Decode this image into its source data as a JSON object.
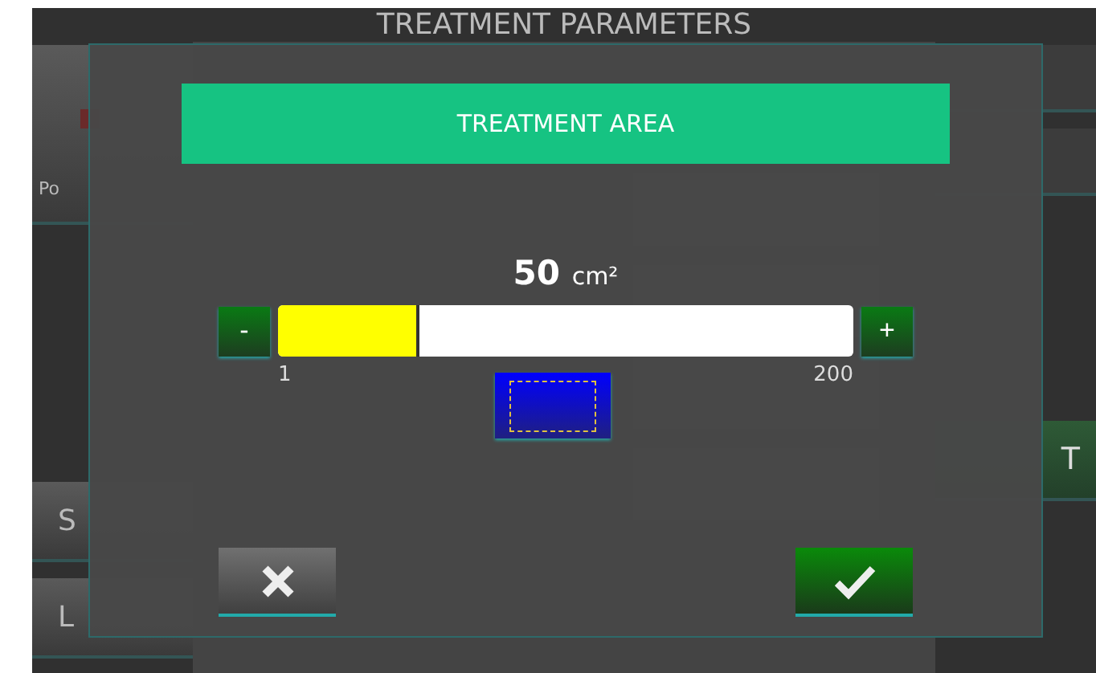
{
  "screen": {
    "title": "TREATMENT PARAMETERS",
    "left_buttons": [
      {
        "label": "Po",
        "kind": "probe"
      },
      {
        "label": "S",
        "kind": "plain"
      },
      {
        "label": "L",
        "kind": "plain"
      }
    ],
    "right_buttons": [
      {
        "label": "T",
        "kind": "start"
      }
    ]
  },
  "dialog": {
    "title": "TREATMENT AREA",
    "value": "50",
    "unit": "cm²",
    "minus": "-",
    "plus": "+",
    "min_label": "1",
    "max_label": "200",
    "level": 0.246
  }
}
